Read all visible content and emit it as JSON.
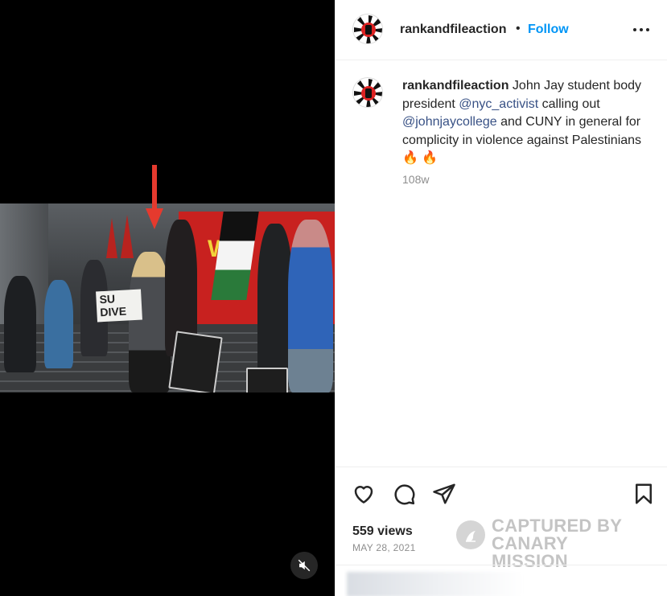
{
  "post": {
    "username": "rankandfileaction",
    "follow_label": "Follow",
    "separator": "•",
    "caption": {
      "username": "rankandfileaction",
      "text_1": " John Jay student body president ",
      "mention_1": "@nyc_activist",
      "text_2": " calling out ",
      "mention_2": "@johnjaycollege",
      "text_3": " and CUNY in general for complicity in violence against Palestinians ",
      "emoji": "🔥 🔥"
    },
    "time_ago": "108w",
    "views": "559 views",
    "date": "MAY 28, 2021"
  },
  "video": {
    "banner_text": "WIT",
    "sign_text": "SU DIVE",
    "muted": true
  },
  "watermark": {
    "line1": "CAPTURED BY",
    "line2": "CANARY MISSION"
  },
  "icons": {
    "like": "heart-icon",
    "comment": "comment-icon",
    "share": "send-icon",
    "save": "bookmark-icon",
    "more": "more-horizontal-icon",
    "mute": "speaker-muted-icon"
  },
  "colors": {
    "follow": "#0095f6",
    "mention": "#385185",
    "arrow": "#e53a2e"
  }
}
